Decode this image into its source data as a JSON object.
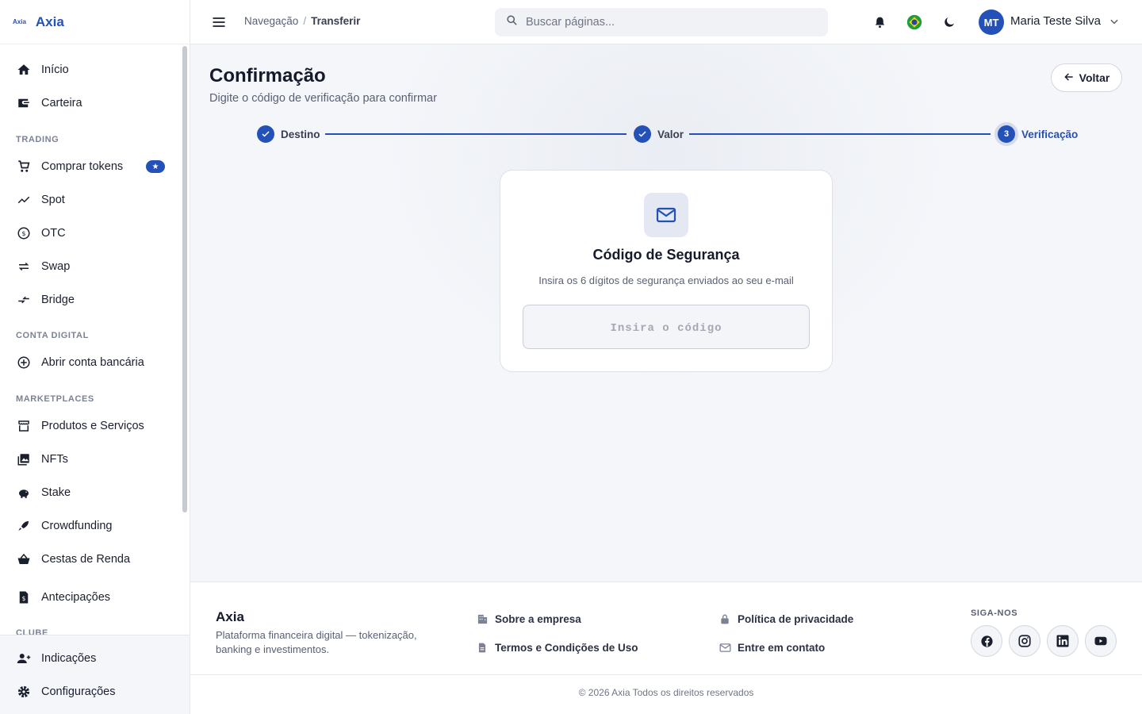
{
  "brand": {
    "mark": "Axia",
    "name": "Axia"
  },
  "sidebar": {
    "items_top": [
      {
        "label": "Início",
        "icon": "home-icon"
      },
      {
        "label": "Carteira",
        "icon": "wallet-icon"
      }
    ],
    "sections": [
      {
        "title": "TRADING",
        "items": [
          {
            "label": "Comprar tokens",
            "icon": "cart-icon",
            "badge": "star"
          },
          {
            "label": "Spot",
            "icon": "chart-line-icon"
          },
          {
            "label": "OTC",
            "icon": "currency-exchange-icon"
          },
          {
            "label": "Swap",
            "icon": "swap-icon"
          },
          {
            "label": "Bridge",
            "icon": "bridge-icon"
          }
        ]
      },
      {
        "title": "CONTA DIGITAL",
        "items": [
          {
            "label": "Abrir conta bancária",
            "icon": "plus-circle-icon"
          }
        ]
      },
      {
        "title": "MARKETPLACES",
        "items": [
          {
            "label": "Produtos e Serviços",
            "icon": "store-icon"
          },
          {
            "label": "NFTs",
            "icon": "image-icon"
          },
          {
            "label": "Stake",
            "icon": "piggy-bank-icon"
          },
          {
            "label": "Crowdfunding",
            "icon": "rocket-icon"
          },
          {
            "label": "Cestas de Renda",
            "icon": "basket-icon"
          },
          {
            "label": "Antecipações",
            "icon": "document-dollar-icon"
          }
        ]
      },
      {
        "title": "CLUBE",
        "items": []
      }
    ],
    "bottom_items": [
      {
        "label": "Indicações",
        "icon": "person-add-icon"
      },
      {
        "label": "Configurações",
        "icon": "gear-icon"
      }
    ]
  },
  "topbar": {
    "breadcrumb": [
      "Navegação",
      "Transferir"
    ],
    "search_placeholder": "Buscar páginas...",
    "user_initials": "MT",
    "user_name": "Maria Teste Silva"
  },
  "page": {
    "title": "Confirmação",
    "subtitle": "Digite o código de verificação para confirmar",
    "back_label": "Voltar"
  },
  "stepper": {
    "steps": [
      {
        "label": "Destino",
        "state": "done"
      },
      {
        "label": "Valor",
        "state": "done"
      },
      {
        "label": "Verificação",
        "state": "active",
        "number": "3"
      }
    ]
  },
  "card": {
    "title": "Código de Segurança",
    "subtitle": "Insira os 6 dígitos de segurança enviados ao seu e-mail",
    "input_placeholder": "Insira o código",
    "input_value": ""
  },
  "footer": {
    "brand": "Axia",
    "description": "Plataforma financeira digital — tokenização, banking e investimentos.",
    "links": [
      {
        "label": "Sobre a empresa",
        "icon": "building-icon"
      },
      {
        "label": "Termos e Condições de Uso",
        "icon": "document-icon"
      },
      {
        "label": "Política de privacidade",
        "icon": "lock-icon"
      },
      {
        "label": "Entre em contato",
        "icon": "mail-icon"
      }
    ],
    "follow_title": "SIGA-NOS",
    "social": [
      "facebook-icon",
      "instagram-icon",
      "linkedin-icon",
      "youtube-icon"
    ],
    "copyright": "© 2026 Axia Todos os direitos reservados"
  },
  "colors": {
    "accent": "#2451b8",
    "background": "#f4f6fa",
    "text": "#1a1f2e"
  }
}
